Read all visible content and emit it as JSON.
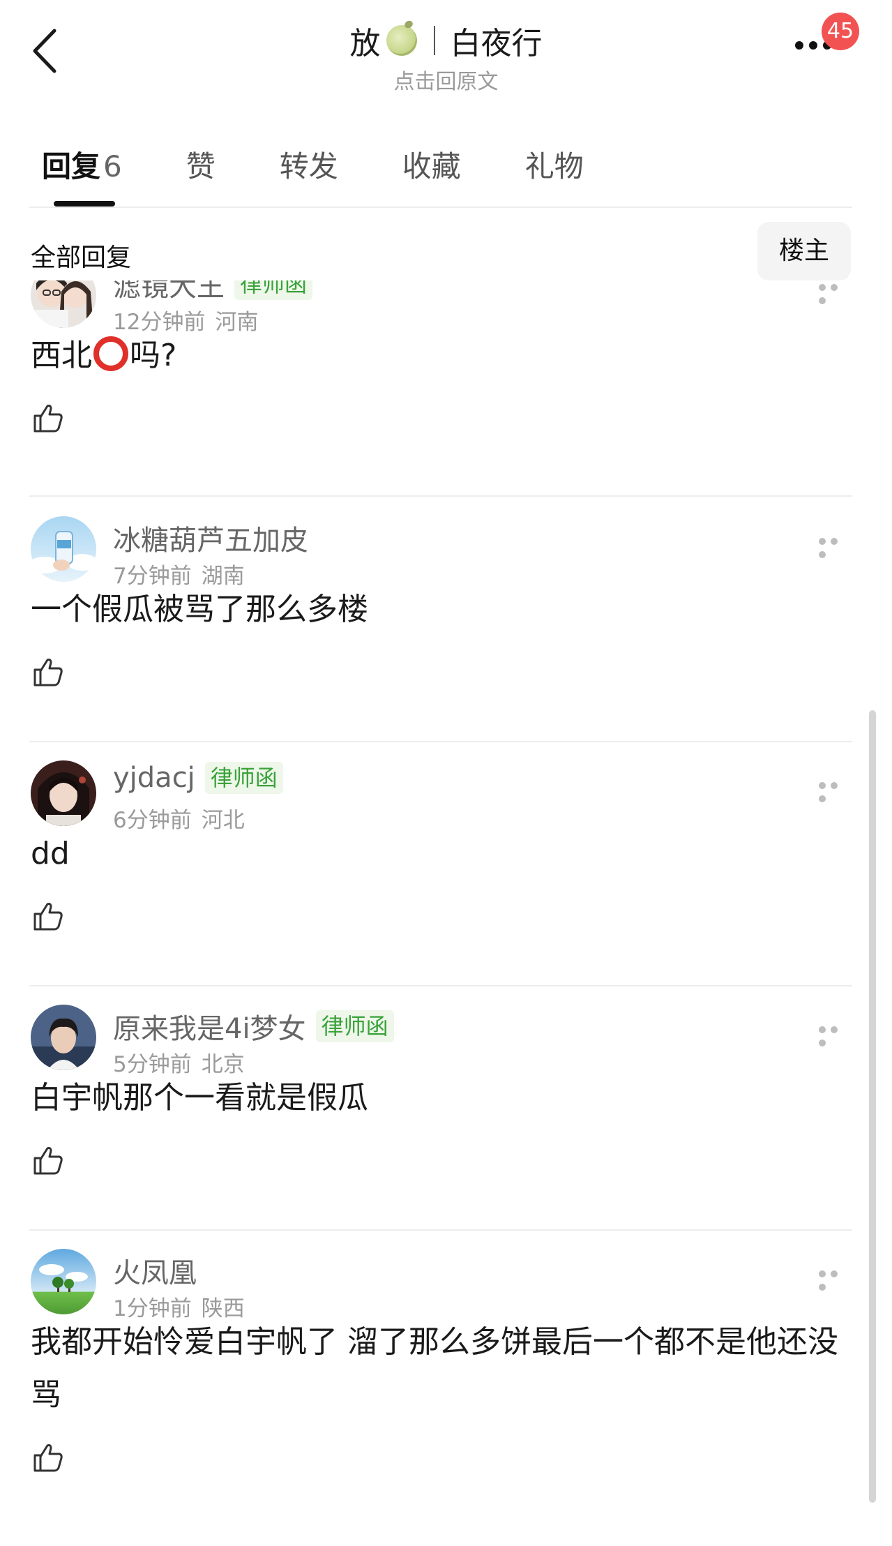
{
  "header": {
    "title_left": "放",
    "title_right": "白夜行",
    "subtitle": "点击回原文",
    "badge_count": "45"
  },
  "tabs": [
    {
      "label": "回复",
      "count": "6",
      "active": true
    },
    {
      "label": "赞"
    },
    {
      "label": "转发"
    },
    {
      "label": "收藏"
    },
    {
      "label": "礼物"
    }
  ],
  "section": {
    "title": "全部回复",
    "sort_button": "楼主"
  },
  "comments": [
    {
      "username": "滤镜大王",
      "tag": "律师函",
      "time": "12分钟前",
      "location": "河南",
      "text_before": "西北",
      "text_after": "吗?"
    },
    {
      "username": "冰糖葫芦五加皮",
      "time": "7分钟前",
      "location": "湖南",
      "text": "一个假瓜被骂了那么多楼"
    },
    {
      "username": "yjdacj",
      "tag": "律师函",
      "time": "6分钟前",
      "location": "河北",
      "text": "dd"
    },
    {
      "username": "原来我是4i梦女",
      "tag": "律师函",
      "time": "5分钟前",
      "location": "北京",
      "text": "白宇帆那个一看就是假瓜"
    },
    {
      "username": "火凤凰",
      "time": "1分钟前",
      "location": "陕西",
      "text": "我都开始怜爱白宇帆了 溜了那么多饼最后一个都不是他还没骂"
    }
  ],
  "colors": {
    "tag_green": "#3aa23a",
    "badge_red": "#f25252",
    "red_circle": "#e0302a"
  },
  "icons": [
    "back-arrow-icon",
    "melon-icon",
    "more-icon",
    "thumbs-up-icon",
    "red-circle-emoji"
  ]
}
